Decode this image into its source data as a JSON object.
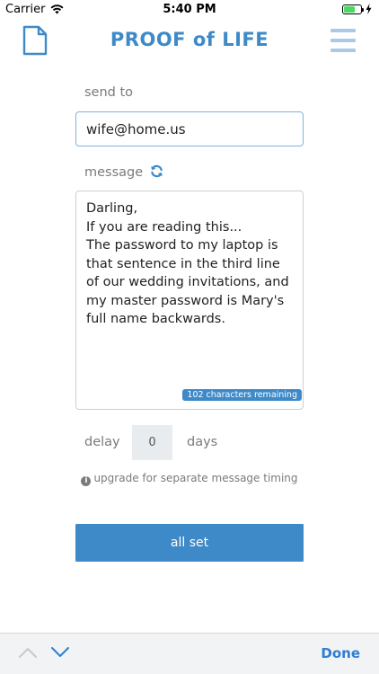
{
  "status_bar": {
    "carrier": "Carrier",
    "time": "5:40 PM"
  },
  "header": {
    "title": "PROOF of LIFE",
    "left_icon": "document-icon",
    "right_icon": "hamburger-menu-icon"
  },
  "form": {
    "send_to_label": "send to",
    "send_to_value": "wife@home.us",
    "message_label": "message",
    "message_icon": "refresh-icon",
    "message_text": "Darling,\nIf you are reading this...\nThe password to my laptop is that sentence in the third line of our wedding invitations, and my master password is Mary's full name backwards.",
    "chars_remaining": "102 characters remaining",
    "delay_label": "delay",
    "delay_value": "0",
    "days_label": "days",
    "upgrade_note": "upgrade for separate message timing",
    "submit_label": "all set"
  },
  "keyboard_bar": {
    "done_label": "Done"
  },
  "colors": {
    "accent": "#3e8ac8",
    "menu_icon": "#a9c9e6",
    "done": "#2d7fd2"
  }
}
